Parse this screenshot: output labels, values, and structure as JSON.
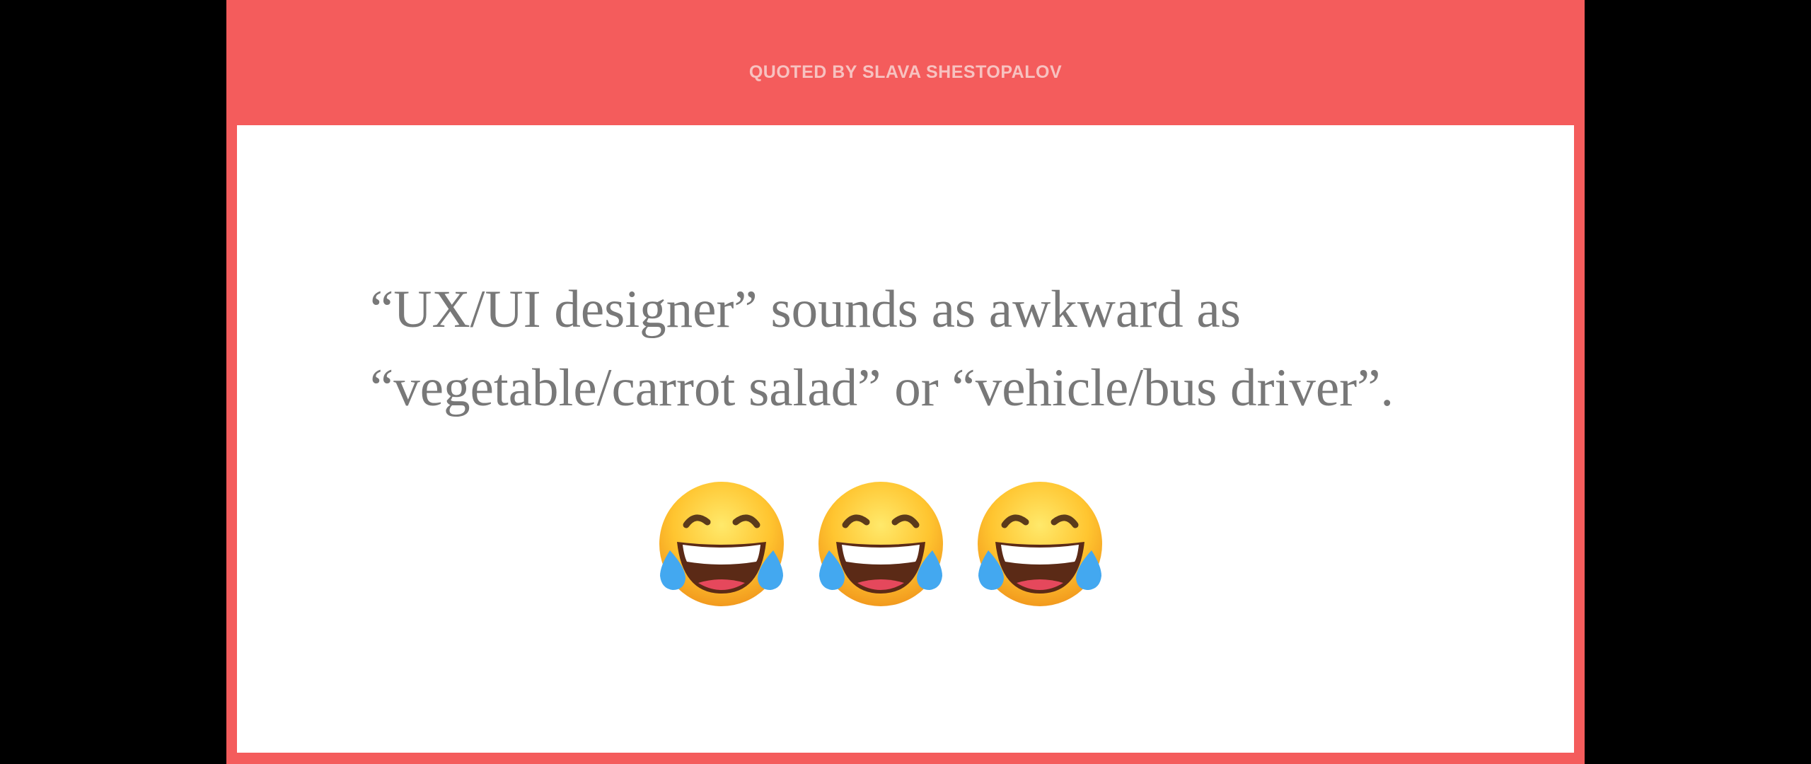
{
  "header": {
    "byline": "QUOTED BY SLAVA SHESTOPALOV"
  },
  "quote": {
    "text": "“UX/UI designer” sounds as awkward as\n“vegetable/carrot salad” or “vehicle/bus driver”."
  },
  "emojis": [
    {
      "icon": "face-with-tears-of-joy-icon"
    },
    {
      "icon": "face-with-tears-of-joy-icon"
    },
    {
      "icon": "face-with-tears-of-joy-icon"
    }
  ],
  "colors": {
    "accent": "#f45c5c",
    "byline": "#f7c2c0",
    "quote_text": "#787878",
    "card": "#ffffff",
    "letterbox": "#000000"
  }
}
